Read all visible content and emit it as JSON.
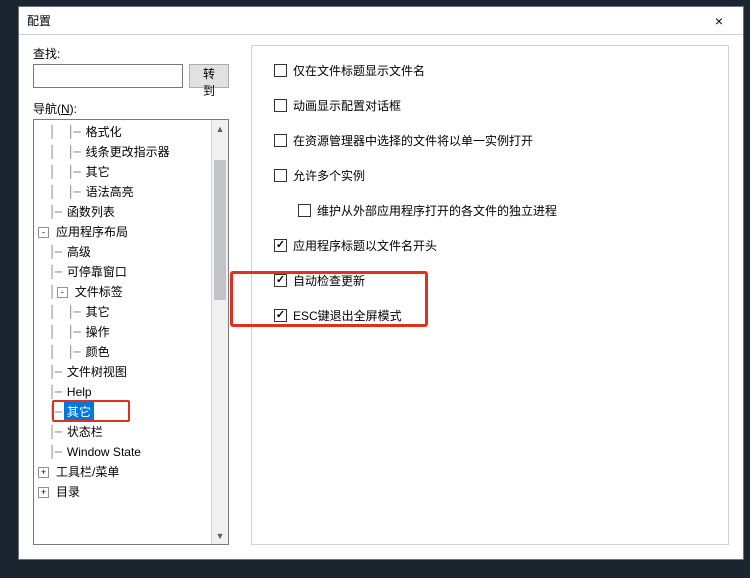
{
  "dialog": {
    "title": "配置",
    "close_icon": "×"
  },
  "search": {
    "label": "查找:",
    "value": "",
    "goto_label": "转到",
    "nav_label_pre": "导航(",
    "nav_label_u": "N",
    "nav_label_post": "):"
  },
  "tree": [
    {
      "depth": 2,
      "toggle": "",
      "label": "格式化"
    },
    {
      "depth": 2,
      "toggle": "",
      "label": "线条更改指示器"
    },
    {
      "depth": 2,
      "toggle": "",
      "label": "其它"
    },
    {
      "depth": 2,
      "toggle": "",
      "label": "语法高亮"
    },
    {
      "depth": 1,
      "toggle": "",
      "label": "函数列表"
    },
    {
      "depth": 0,
      "toggle": "-",
      "label": "应用程序布局"
    },
    {
      "depth": 1,
      "toggle": "",
      "label": "高级"
    },
    {
      "depth": 1,
      "toggle": "",
      "label": "可停靠窗口"
    },
    {
      "depth": 1,
      "toggle": "-",
      "label": "文件标签"
    },
    {
      "depth": 2,
      "toggle": "",
      "label": "其它"
    },
    {
      "depth": 2,
      "toggle": "",
      "label": "操作"
    },
    {
      "depth": 2,
      "toggle": "",
      "label": "颜色"
    },
    {
      "depth": 1,
      "toggle": "",
      "label": "文件树视图"
    },
    {
      "depth": 1,
      "toggle": "",
      "label": "Help"
    },
    {
      "depth": 1,
      "toggle": "",
      "label": "其它",
      "selected": true,
      "redbox": true
    },
    {
      "depth": 1,
      "toggle": "",
      "label": "状态栏"
    },
    {
      "depth": 1,
      "toggle": "",
      "label": "Window State"
    },
    {
      "depth": 0,
      "toggle": "+",
      "label": "工具栏/菜单"
    },
    {
      "depth": 0,
      "toggle": "+",
      "label": "目录"
    }
  ],
  "options": [
    {
      "checked": false,
      "label": "仅在文件标题显示文件名",
      "indent": false
    },
    {
      "checked": false,
      "label": "动画显示配置对话框",
      "indent": false
    },
    {
      "checked": false,
      "label": "在资源管理器中选择的文件将以单一实例打开",
      "indent": false
    },
    {
      "checked": false,
      "label": "允许多个实例",
      "indent": false
    },
    {
      "checked": false,
      "label": "维护从外部应用程序打开的各文件的独立进程",
      "indent": true
    },
    {
      "checked": true,
      "label": "应用程序标题以文件名开头",
      "indent": false
    },
    {
      "checked": true,
      "label": "自动检查更新",
      "indent": false,
      "highlight": true
    },
    {
      "checked": true,
      "label": "ESC键退出全屏模式",
      "indent": false,
      "highlight": true
    }
  ],
  "scrollbar": {
    "up": "▲",
    "down": "▼"
  }
}
